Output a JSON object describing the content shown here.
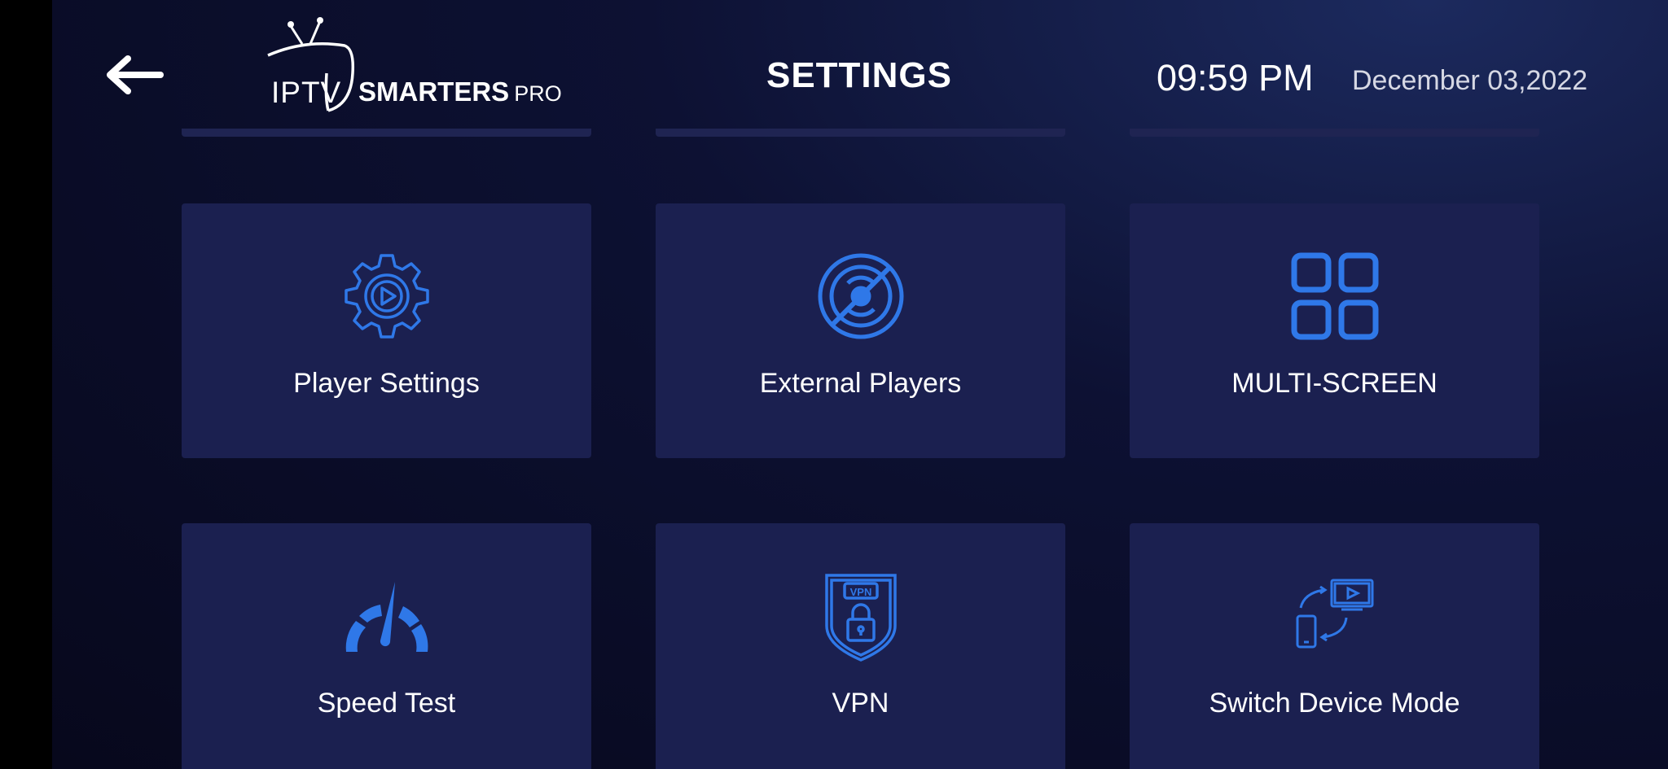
{
  "header": {
    "logo": {
      "iptv": "IPTV",
      "smarters": "SMARTERS",
      "pro": "PRO"
    },
    "title": "SETTINGS",
    "time": "09:59 PM",
    "date": "December 03,2022",
    "back_icon": "arrow-left-icon"
  },
  "colors": {
    "accent_icon": "#2f78e8",
    "tile_bg": "#1b2050",
    "background": "#0b0e2b"
  },
  "tiles": [
    {
      "label": "Player Settings",
      "icon": "gear-play-icon"
    },
    {
      "label": "External Players",
      "icon": "disc-off-icon"
    },
    {
      "label": "MULTI-SCREEN",
      "icon": "grid-icon"
    },
    {
      "label": "Speed Test",
      "icon": "speedometer-icon"
    },
    {
      "label": "VPN",
      "icon": "vpn-shield-lock-icon"
    },
    {
      "label": "Switch Device Mode",
      "icon": "device-switch-icon"
    }
  ]
}
